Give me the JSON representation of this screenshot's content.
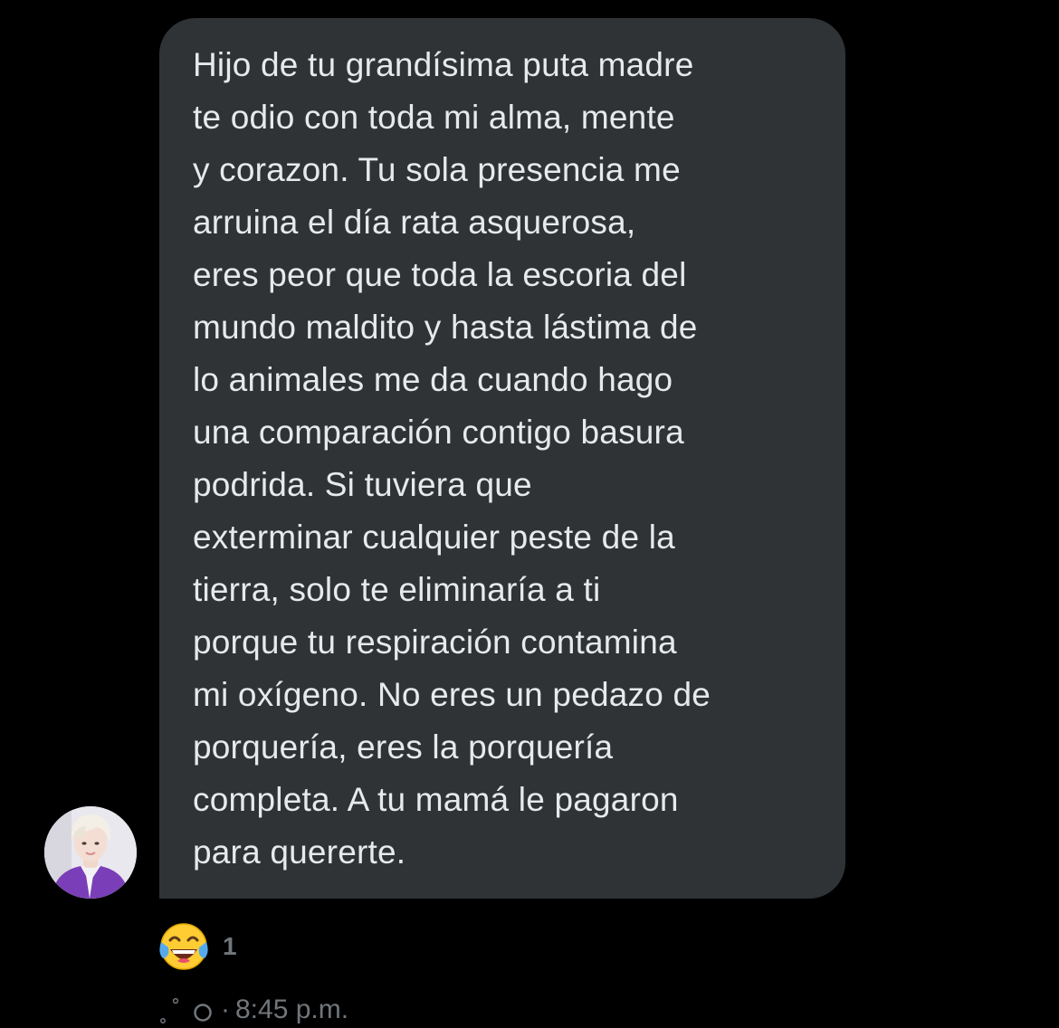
{
  "message": {
    "lines": [
      "Hijo de tu grandísima puta madre",
      "te odio con toda mi alma, mente",
      "y corazon. Tu sola presencia me",
      "arruina el día rata asquerosa,",
      "eres peor que toda la escoria del",
      "mundo maldito y hasta lástima de",
      "lo animales me da cuando hago",
      "una comparación contigo basura",
      "podrida. Si tuviera que",
      "exterminar cualquier peste de la",
      "tierra, solo te eliminaría a ti",
      "porque tu respiración contamina",
      "mi oxígeno. No eres un pedazo de",
      "porquería, eres la porquería",
      "completa. A tu mamá le pagaron",
      "para quererte."
    ]
  },
  "reaction": {
    "emoji": "face-with-tears-of-joy",
    "count": "1"
  },
  "meta": {
    "status_icon": "sending-status-icon",
    "separator": "·",
    "time": "8:45 p.m."
  },
  "colors": {
    "background": "#000000",
    "bubble": "#2f3336",
    "text": "#e7e9ea",
    "muted": "#71767b"
  }
}
